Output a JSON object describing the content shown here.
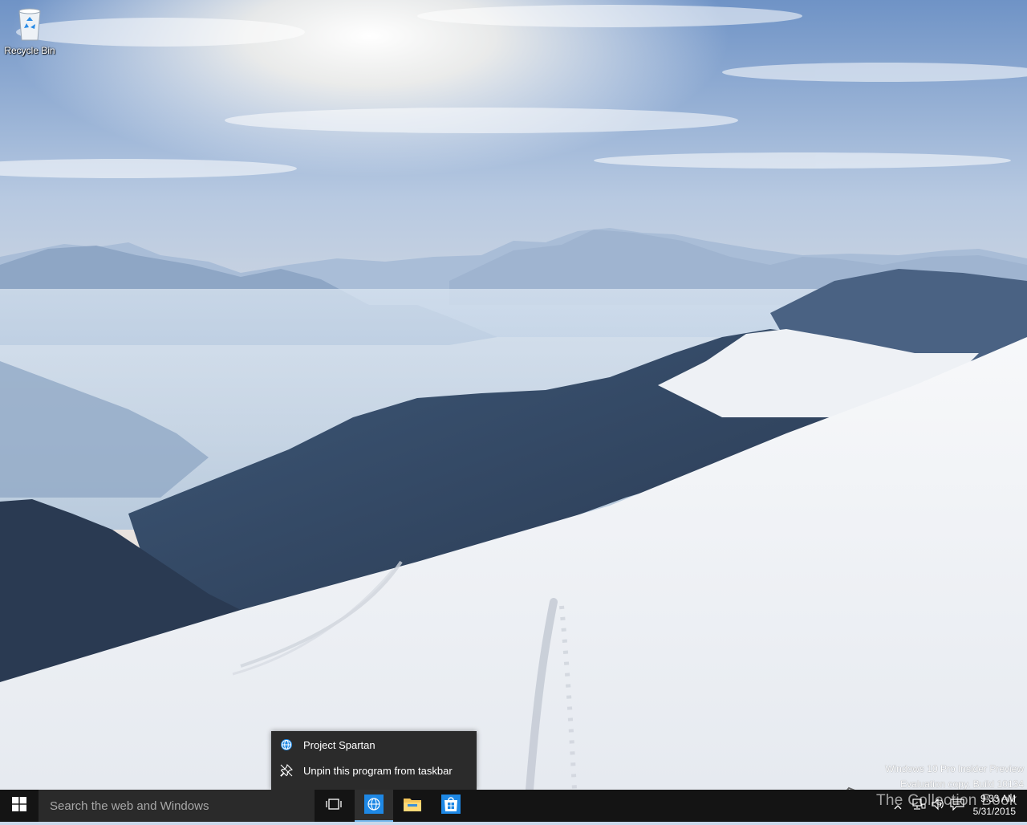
{
  "desktop": {
    "icons": [
      {
        "label": "Recycle Bin",
        "icon": "recycle-bin-icon"
      }
    ],
    "watermark": {
      "line1": "Windows 10 Pro Insider Preview",
      "line2": "Evaluation copy. Build 10134"
    }
  },
  "jumplist": {
    "items": [
      {
        "label": "Project Spartan",
        "icon": "globe-icon"
      },
      {
        "label": "Unpin this program from taskbar",
        "icon": "unpin-icon"
      }
    ]
  },
  "taskbar": {
    "start": {
      "icon": "windows-logo-icon"
    },
    "search": {
      "placeholder": "Search the web and Windows"
    },
    "buttons": [
      {
        "name": "task-view",
        "icon": "task-view-icon"
      },
      {
        "name": "project-spartan",
        "icon": "globe-icon",
        "active": true
      },
      {
        "name": "file-explorer",
        "icon": "folder-icon"
      },
      {
        "name": "store",
        "icon": "store-icon"
      }
    ],
    "tray": {
      "time": "9:33 AM",
      "date": "5/31/2015",
      "icons": [
        "chevron-up-icon",
        "network-icon",
        "volume-icon",
        "action-center-icon"
      ]
    }
  },
  "branding": {
    "text": "The Collection Book"
  },
  "colors": {
    "taskbar": "#141414",
    "search_box": "#2a2a2a",
    "accent": "#76b9ed",
    "jumplist_bg": "#2b2b2b"
  }
}
